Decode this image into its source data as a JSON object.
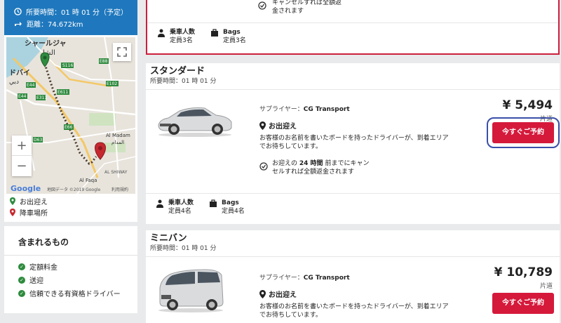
{
  "trip": {
    "duration": "所要時間：01 時 01 分（予定）",
    "distance": "距離：74.672km"
  },
  "map": {
    "labels": {
      "sharjah_en": "シャールジャ",
      "sharjah_ar": "الشا",
      "dubai_en": "ドバイ",
      "dubai_ar": "دبي",
      "al_madam": "Al Madam",
      "al_madam_ar": "المدام",
      "al_shiway": "AL SHIWAY",
      "al_faqa": "Al Faqa",
      "google": "Google",
      "attribution": "地図データ ©2019 Google",
      "terms": "利用規約"
    },
    "roads": [
      "S116",
      "E88",
      "E102",
      "E611",
      "E44",
      "E44",
      "E311",
      "E66",
      "D63"
    ],
    "zoom_in": "+",
    "zoom_out": "−"
  },
  "legend": {
    "pickup": "お出迎え",
    "dropoff": "降車場所"
  },
  "includes": {
    "title": "含まれるもの",
    "items": [
      "定額料金",
      "送迎",
      "信頼できる有資格ドライバー"
    ]
  },
  "selected": {
    "cancel_text": "キャンセルすれば全額返金されます",
    "pax_label": "乗車人数",
    "pax_value": "定員3名",
    "bags_label": "Bags",
    "bags_value": "定員3名"
  },
  "cards": [
    {
      "title": "スタンダード",
      "duration": "所要時間：01 時 01 分",
      "supplier_label": "サプライヤー：",
      "supplier": "CG Transport",
      "pickup": "お出迎え",
      "description": "お客様のお名前を書いたボードを持ったドライバーが、到着エリアでお待ちしています。",
      "cancel_pre": "お迎えの",
      "cancel_hours": "24 時間",
      "cancel_post": "前までにキャンセルすれば全額返金されます",
      "price": "¥ 5,494",
      "price_unit": "片道",
      "book": "今すぐご予約",
      "pax_label": "乗車人数",
      "pax_value": "定員4名",
      "bags_label": "Bags",
      "bags_value": "定員4名"
    },
    {
      "title": "ミニバン",
      "duration": "所要時間：01 時 01 分",
      "supplier_label": "サプライヤー：",
      "supplier": "CG Transport",
      "pickup": "お出迎え",
      "description": "お客様のお名前を書いたボードを持ったドライバーが、到着エリアでお待ちしています。",
      "price": "¥ 10,789",
      "price_unit": "片道",
      "book": "今すぐご予約"
    }
  ],
  "colors": {
    "brand_blue": "#1f78bd",
    "book_red": "#d5193b",
    "selected_border": "#cc1f3c",
    "highlight_outline": "#3a4fa8",
    "check_green": "#2e8b3d"
  }
}
